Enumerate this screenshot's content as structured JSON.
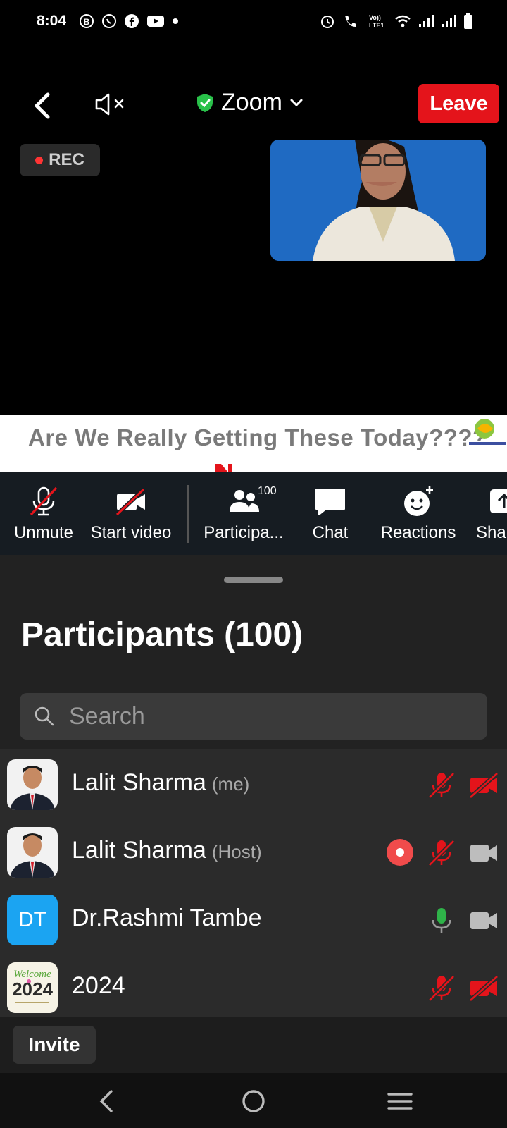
{
  "status_bar": {
    "time": "8:04",
    "icons": [
      "b-icon",
      "whatsapp-icon",
      "facebook-icon",
      "youtube-icon",
      "dot-icon",
      "alarm-icon",
      "call-icon",
      "volte-icon",
      "wifi-icon",
      "signal-icon",
      "signal-icon",
      "battery-icon"
    ]
  },
  "top_bar": {
    "title": "Zoom",
    "leave_label": "Leave",
    "rec_label": "REC"
  },
  "banner": {
    "text": "Are We Really Getting These Today????"
  },
  "toolbar": {
    "items": [
      {
        "label": "Unmute",
        "icon": "mic-muted-icon"
      },
      {
        "label": "Start video",
        "icon": "video-off-icon"
      },
      {
        "label": "Participa...",
        "icon": "participants-icon",
        "badge": "100"
      },
      {
        "label": "Chat",
        "icon": "chat-icon"
      },
      {
        "label": "Reactions",
        "icon": "reactions-icon"
      },
      {
        "label": "Sha",
        "icon": "share-icon"
      }
    ]
  },
  "participants": {
    "title": "Participants (100)",
    "search_placeholder": "Search",
    "rows": [
      {
        "name": "Lalit Sharma",
        "tag": "(me)",
        "avatar": "photo",
        "mic": "muted",
        "video": "off",
        "recording": false
      },
      {
        "name": "Lalit Sharma",
        "tag": "(Host)",
        "avatar": "photo",
        "mic": "muted",
        "video": "on",
        "recording": true
      },
      {
        "name": "Dr.Rashmi Tambe",
        "tag": "",
        "avatar_initials": "DT",
        "mic": "active",
        "video": "on",
        "recording": false
      },
      {
        "name": "2024",
        "tag": "",
        "avatar_text": "Welcome",
        "avatar_year": "2024",
        "mic": "muted",
        "video": "off",
        "recording": false
      }
    ],
    "invite_label": "Invite"
  },
  "colors": {
    "leave": "#e4141b",
    "muted": "#e4141b",
    "active_mic": "#2fb349",
    "initials_avatar": "#1ba4f2",
    "shield": "#29c14a"
  }
}
